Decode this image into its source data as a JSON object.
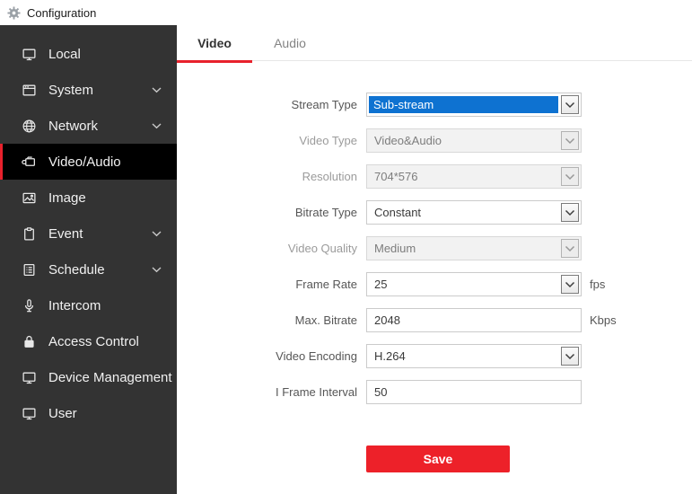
{
  "header": {
    "title": "Configuration",
    "icon": "gear-icon"
  },
  "sidebar": {
    "items": [
      {
        "label": "Local",
        "icon": "monitor",
        "chevron": false,
        "selected": false
      },
      {
        "label": "System",
        "icon": "window",
        "chevron": true,
        "selected": false
      },
      {
        "label": "Network",
        "icon": "globe",
        "chevron": true,
        "selected": false
      },
      {
        "label": "Video/Audio",
        "icon": "camera",
        "chevron": false,
        "selected": true
      },
      {
        "label": "Image",
        "icon": "image",
        "chevron": false,
        "selected": false
      },
      {
        "label": "Event",
        "icon": "clipboard",
        "chevron": true,
        "selected": false
      },
      {
        "label": "Schedule",
        "icon": "schedule",
        "chevron": true,
        "selected": false
      },
      {
        "label": "Intercom",
        "icon": "microphone",
        "chevron": false,
        "selected": false
      },
      {
        "label": "Access Control",
        "icon": "lock",
        "chevron": false,
        "selected": false
      },
      {
        "label": "Device Management",
        "icon": "monitor",
        "chevron": false,
        "selected": false
      },
      {
        "label": "User",
        "icon": "monitor",
        "chevron": false,
        "selected": false
      }
    ]
  },
  "tabs": [
    {
      "label": "Video",
      "active": true
    },
    {
      "label": "Audio",
      "active": false
    }
  ],
  "form": {
    "fields": [
      {
        "label": "Stream Type",
        "value": "Sub-stream",
        "type": "select",
        "state": "focused",
        "suffix": ""
      },
      {
        "label": "Video Type",
        "value": "Video&Audio",
        "type": "select",
        "state": "disabled",
        "suffix": ""
      },
      {
        "label": "Resolution",
        "value": "704*576",
        "type": "select",
        "state": "disabled",
        "suffix": ""
      },
      {
        "label": "Bitrate Type",
        "value": "Constant",
        "type": "select",
        "state": "enabled",
        "suffix": ""
      },
      {
        "label": "Video Quality",
        "value": "Medium",
        "type": "select",
        "state": "disabled",
        "suffix": ""
      },
      {
        "label": "Frame Rate",
        "value": "25",
        "type": "select",
        "state": "enabled",
        "suffix": "fps"
      },
      {
        "label": "Max. Bitrate",
        "value": "2048",
        "type": "text",
        "state": "enabled",
        "suffix": "Kbps"
      },
      {
        "label": "Video Encoding",
        "value": "H.264",
        "type": "select",
        "state": "enabled",
        "suffix": ""
      },
      {
        "label": "I Frame Interval",
        "value": "50",
        "type": "text",
        "state": "enabled",
        "suffix": ""
      }
    ],
    "save_label": "Save"
  },
  "colors": {
    "accent_red": "#e8212c",
    "save_red": "#ed2129",
    "selection_blue": "#0e72d1",
    "sidebar_bg": "#333333",
    "sidebar_selected_bg": "#000000"
  }
}
